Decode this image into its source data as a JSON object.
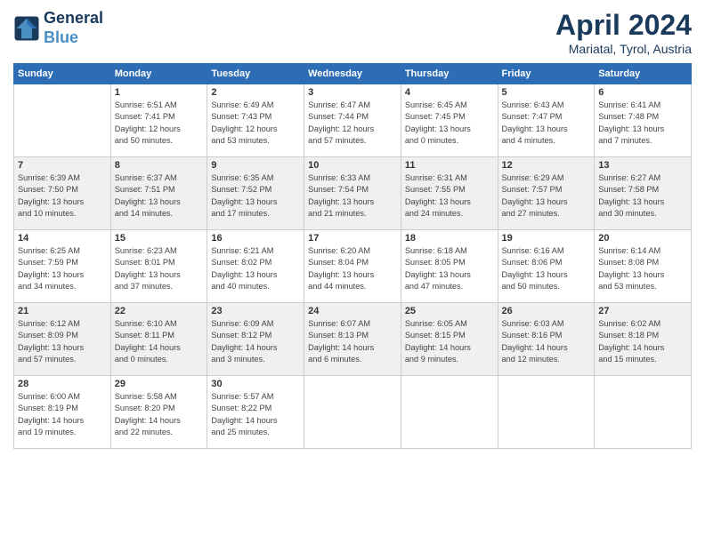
{
  "header": {
    "logo_line1": "General",
    "logo_line2": "Blue",
    "month": "April 2024",
    "location": "Mariatal, Tyrol, Austria"
  },
  "days_of_week": [
    "Sunday",
    "Monday",
    "Tuesday",
    "Wednesday",
    "Thursday",
    "Friday",
    "Saturday"
  ],
  "weeks": [
    [
      {
        "day": "",
        "info": ""
      },
      {
        "day": "1",
        "info": "Sunrise: 6:51 AM\nSunset: 7:41 PM\nDaylight: 12 hours\nand 50 minutes."
      },
      {
        "day": "2",
        "info": "Sunrise: 6:49 AM\nSunset: 7:43 PM\nDaylight: 12 hours\nand 53 minutes."
      },
      {
        "day": "3",
        "info": "Sunrise: 6:47 AM\nSunset: 7:44 PM\nDaylight: 12 hours\nand 57 minutes."
      },
      {
        "day": "4",
        "info": "Sunrise: 6:45 AM\nSunset: 7:45 PM\nDaylight: 13 hours\nand 0 minutes."
      },
      {
        "day": "5",
        "info": "Sunrise: 6:43 AM\nSunset: 7:47 PM\nDaylight: 13 hours\nand 4 minutes."
      },
      {
        "day": "6",
        "info": "Sunrise: 6:41 AM\nSunset: 7:48 PM\nDaylight: 13 hours\nand 7 minutes."
      }
    ],
    [
      {
        "day": "7",
        "info": "Sunrise: 6:39 AM\nSunset: 7:50 PM\nDaylight: 13 hours\nand 10 minutes."
      },
      {
        "day": "8",
        "info": "Sunrise: 6:37 AM\nSunset: 7:51 PM\nDaylight: 13 hours\nand 14 minutes."
      },
      {
        "day": "9",
        "info": "Sunrise: 6:35 AM\nSunset: 7:52 PM\nDaylight: 13 hours\nand 17 minutes."
      },
      {
        "day": "10",
        "info": "Sunrise: 6:33 AM\nSunset: 7:54 PM\nDaylight: 13 hours\nand 21 minutes."
      },
      {
        "day": "11",
        "info": "Sunrise: 6:31 AM\nSunset: 7:55 PM\nDaylight: 13 hours\nand 24 minutes."
      },
      {
        "day": "12",
        "info": "Sunrise: 6:29 AM\nSunset: 7:57 PM\nDaylight: 13 hours\nand 27 minutes."
      },
      {
        "day": "13",
        "info": "Sunrise: 6:27 AM\nSunset: 7:58 PM\nDaylight: 13 hours\nand 30 minutes."
      }
    ],
    [
      {
        "day": "14",
        "info": "Sunrise: 6:25 AM\nSunset: 7:59 PM\nDaylight: 13 hours\nand 34 minutes."
      },
      {
        "day": "15",
        "info": "Sunrise: 6:23 AM\nSunset: 8:01 PM\nDaylight: 13 hours\nand 37 minutes."
      },
      {
        "day": "16",
        "info": "Sunrise: 6:21 AM\nSunset: 8:02 PM\nDaylight: 13 hours\nand 40 minutes."
      },
      {
        "day": "17",
        "info": "Sunrise: 6:20 AM\nSunset: 8:04 PM\nDaylight: 13 hours\nand 44 minutes."
      },
      {
        "day": "18",
        "info": "Sunrise: 6:18 AM\nSunset: 8:05 PM\nDaylight: 13 hours\nand 47 minutes."
      },
      {
        "day": "19",
        "info": "Sunrise: 6:16 AM\nSunset: 8:06 PM\nDaylight: 13 hours\nand 50 minutes."
      },
      {
        "day": "20",
        "info": "Sunrise: 6:14 AM\nSunset: 8:08 PM\nDaylight: 13 hours\nand 53 minutes."
      }
    ],
    [
      {
        "day": "21",
        "info": "Sunrise: 6:12 AM\nSunset: 8:09 PM\nDaylight: 13 hours\nand 57 minutes."
      },
      {
        "day": "22",
        "info": "Sunrise: 6:10 AM\nSunset: 8:11 PM\nDaylight: 14 hours\nand 0 minutes."
      },
      {
        "day": "23",
        "info": "Sunrise: 6:09 AM\nSunset: 8:12 PM\nDaylight: 14 hours\nand 3 minutes."
      },
      {
        "day": "24",
        "info": "Sunrise: 6:07 AM\nSunset: 8:13 PM\nDaylight: 14 hours\nand 6 minutes."
      },
      {
        "day": "25",
        "info": "Sunrise: 6:05 AM\nSunset: 8:15 PM\nDaylight: 14 hours\nand 9 minutes."
      },
      {
        "day": "26",
        "info": "Sunrise: 6:03 AM\nSunset: 8:16 PM\nDaylight: 14 hours\nand 12 minutes."
      },
      {
        "day": "27",
        "info": "Sunrise: 6:02 AM\nSunset: 8:18 PM\nDaylight: 14 hours\nand 15 minutes."
      }
    ],
    [
      {
        "day": "28",
        "info": "Sunrise: 6:00 AM\nSunset: 8:19 PM\nDaylight: 14 hours\nand 19 minutes."
      },
      {
        "day": "29",
        "info": "Sunrise: 5:58 AM\nSunset: 8:20 PM\nDaylight: 14 hours\nand 22 minutes."
      },
      {
        "day": "30",
        "info": "Sunrise: 5:57 AM\nSunset: 8:22 PM\nDaylight: 14 hours\nand 25 minutes."
      },
      {
        "day": "",
        "info": ""
      },
      {
        "day": "",
        "info": ""
      },
      {
        "day": "",
        "info": ""
      },
      {
        "day": "",
        "info": ""
      }
    ]
  ]
}
